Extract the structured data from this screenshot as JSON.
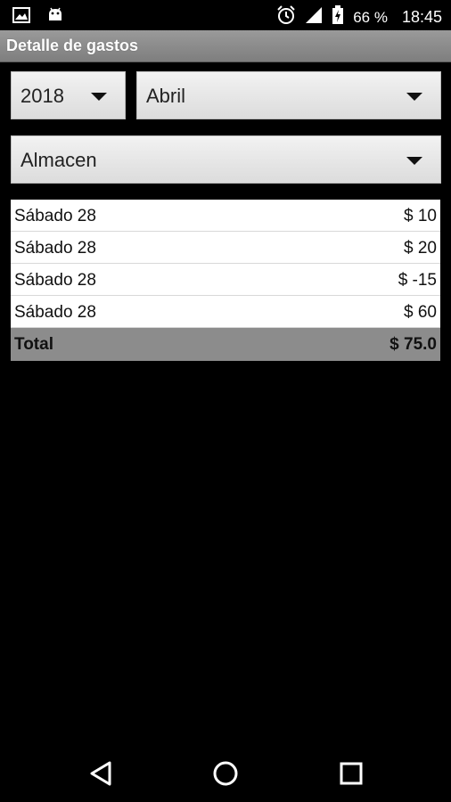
{
  "status_bar": {
    "left_icons": [
      "image-icon",
      "android-icon"
    ],
    "right_icons": [
      "alarm-icon",
      "signal-icon",
      "battery-charging-icon"
    ],
    "battery": "66 %",
    "time": "18:45"
  },
  "app": {
    "title": "Detalle de gastos"
  },
  "filters": {
    "year": "2018",
    "month": "Abril",
    "category": "Almacen"
  },
  "expenses": {
    "rows": [
      {
        "date": "Sábado 28",
        "amount": "$ 10"
      },
      {
        "date": "Sábado 28",
        "amount": "$ 20"
      },
      {
        "date": "Sábado 28",
        "amount": "$ -15"
      },
      {
        "date": "Sábado 28",
        "amount": "$ 60"
      }
    ],
    "total_label": "Total",
    "total_amount": "$ 75.0"
  },
  "nav_bar": {
    "icons": [
      "back-icon",
      "home-icon",
      "recents-icon"
    ]
  }
}
